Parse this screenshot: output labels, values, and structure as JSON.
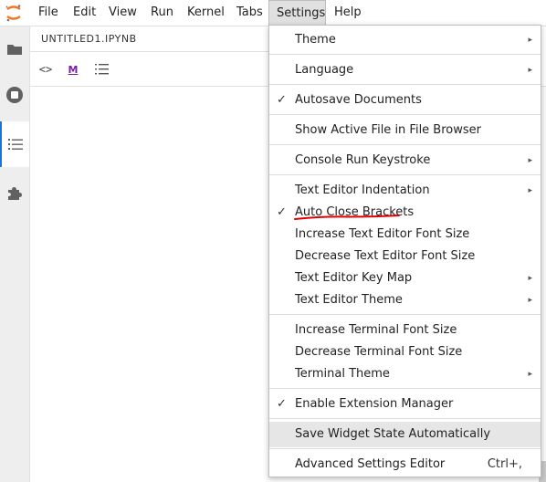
{
  "menubar": {
    "items": [
      "File",
      "Edit",
      "View",
      "Run",
      "Kernel",
      "Tabs",
      "Settings",
      "Help"
    ],
    "active": "Settings"
  },
  "document": {
    "tab_title": "UNTITLED1.IPYNB"
  },
  "toolbar": {
    "code_symbol": "<>",
    "markdown_symbol": "M"
  },
  "settings_menu": {
    "items": [
      {
        "label": "Theme",
        "checked": false,
        "submenu": true,
        "shortcut": ""
      },
      {
        "label": "Language",
        "checked": false,
        "submenu": true,
        "shortcut": ""
      },
      {
        "label": "Autosave Documents",
        "checked": true,
        "submenu": false,
        "shortcut": ""
      },
      {
        "label": "Show Active File in File Browser",
        "checked": false,
        "submenu": false,
        "shortcut": ""
      },
      {
        "label": "Console Run Keystroke",
        "checked": false,
        "submenu": true,
        "shortcut": ""
      },
      {
        "label": "Text Editor Indentation",
        "checked": false,
        "submenu": true,
        "shortcut": ""
      },
      {
        "label": "Auto Close Brackets",
        "checked": true,
        "submenu": false,
        "shortcut": ""
      },
      {
        "label": "Increase Text Editor Font Size",
        "checked": false,
        "submenu": false,
        "shortcut": ""
      },
      {
        "label": "Decrease Text Editor Font Size",
        "checked": false,
        "submenu": false,
        "shortcut": ""
      },
      {
        "label": "Text Editor Key Map",
        "checked": false,
        "submenu": true,
        "shortcut": ""
      },
      {
        "label": "Text Editor Theme",
        "checked": false,
        "submenu": true,
        "shortcut": ""
      },
      {
        "label": "Increase Terminal Font Size",
        "checked": false,
        "submenu": false,
        "shortcut": ""
      },
      {
        "label": "Decrease Terminal Font Size",
        "checked": false,
        "submenu": false,
        "shortcut": ""
      },
      {
        "label": "Terminal Theme",
        "checked": false,
        "submenu": true,
        "shortcut": ""
      },
      {
        "label": "Enable Extension Manager",
        "checked": true,
        "submenu": false,
        "shortcut": ""
      },
      {
        "label": "Save Widget State Automatically",
        "checked": false,
        "submenu": false,
        "shortcut": "",
        "highlighted": true
      },
      {
        "label": "Advanced Settings Editor",
        "checked": false,
        "submenu": false,
        "shortcut": "Ctrl+,"
      }
    ]
  },
  "colors": {
    "jupyter_orange": "#f37626",
    "markdown_purple": "#7b1fa2",
    "annotation_red": "#e00000",
    "active_tab_blue": "#1976d2"
  },
  "icons": {
    "sidebar": [
      "folder-icon",
      "stop-circle-icon",
      "list-icon",
      "puzzle-icon"
    ],
    "submenu_arrow": "▸",
    "check": "✓"
  }
}
